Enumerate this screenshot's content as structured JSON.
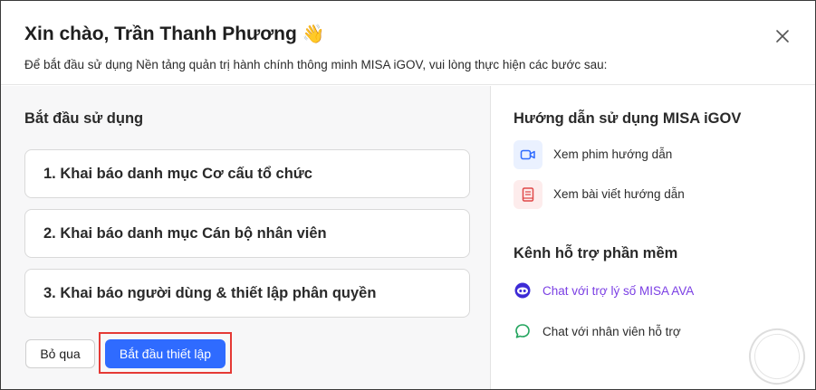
{
  "dialog": {
    "title": "Xin chào, Trần Thanh Phương",
    "wave_emoji": "👋",
    "subtitle": "Để bắt đầu sử dụng Nền tảng quản trị hành chính thông minh MISA iGOV, vui lòng thực hiện các bước sau:",
    "close_icon": "close-icon"
  },
  "getting_started": {
    "title": "Bắt đầu sử dụng",
    "steps": [
      {
        "label": "1. Khai báo danh mục Cơ cấu tổ chức"
      },
      {
        "label": "2. Khai báo danh mục Cán bộ nhân viên"
      },
      {
        "label": "3. Khai báo người dùng & thiết lập phân quyền"
      }
    ],
    "skip_label": "Bỏ qua",
    "start_label": "Bắt đầu thiết lập",
    "start_button_color": "#2f6bff",
    "highlight_color": "#e53935"
  },
  "guide": {
    "title": "Hướng dẫn sử dụng MISA iGOV",
    "items": [
      {
        "label": "Xem phim hướng dẫn",
        "icon": "video-icon"
      },
      {
        "label": "Xem bài viết hướng dẫn",
        "icon": "book-icon"
      }
    ]
  },
  "support": {
    "title": "Kênh hỗ trợ phần mềm",
    "items": [
      {
        "label": "Chat với trợ lý số MISA AVA",
        "icon": "ava-bot-icon",
        "color": "#7b3fe4"
      },
      {
        "label": "Chat với nhân viên hỗ trợ",
        "icon": "chat-bubble-icon",
        "color": "#22a45d"
      }
    ]
  },
  "watermark": {
    "icon": "watermark-stamp"
  }
}
